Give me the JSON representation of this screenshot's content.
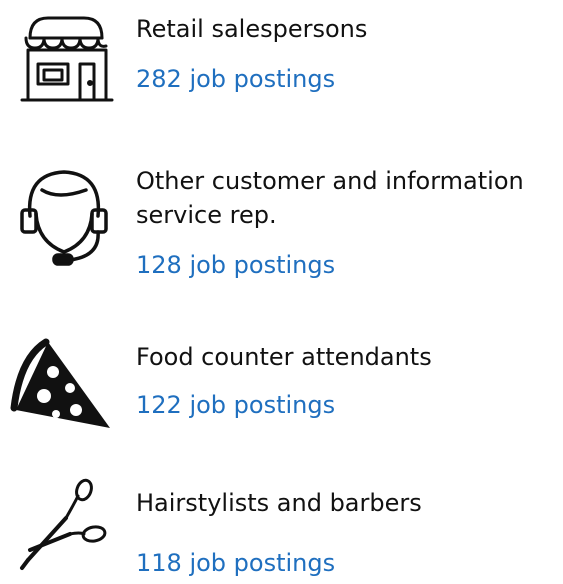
{
  "jobs": [
    {
      "title": "Retail salespersons",
      "postings": "282 job postings",
      "icon": "storefront-icon"
    },
    {
      "title": "Other customer and information service rep.",
      "postings": "128 job postings",
      "icon": "headset-agent-icon"
    },
    {
      "title": "Food counter attendants",
      "postings": "122 job postings",
      "icon": "pizza-slice-icon"
    },
    {
      "title": "Hairstylists and barbers",
      "postings": "118 job postings",
      "icon": "scissors-icon"
    }
  ],
  "colors": {
    "link": "#1f6fbf",
    "text": "#111111"
  }
}
